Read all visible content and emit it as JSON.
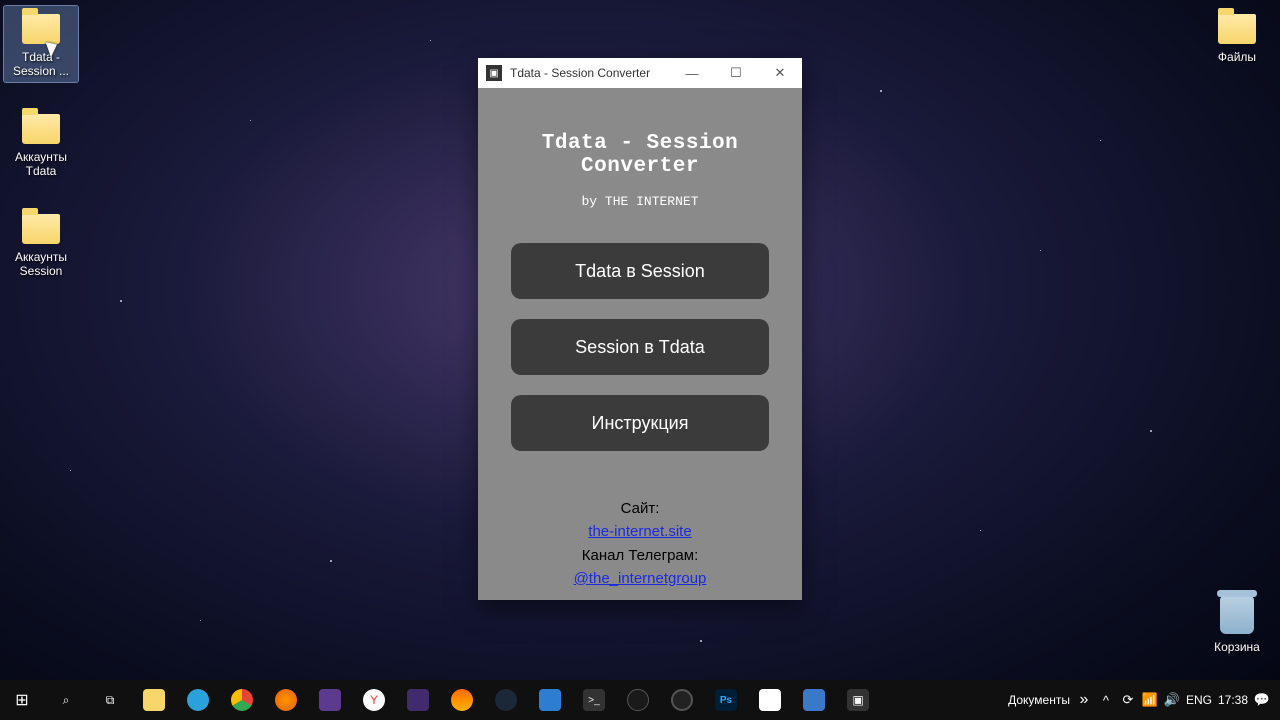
{
  "desktop": {
    "icons_left": [
      {
        "label": "Tdata - Session ...",
        "selected": true
      },
      {
        "label": "Аккаунты Tdata",
        "selected": false
      },
      {
        "label": "Аккаунты Session",
        "selected": false
      }
    ],
    "icons_right": [
      {
        "label": "Файлы"
      }
    ],
    "recycle_bin": "Корзина"
  },
  "window": {
    "title": "Tdata - Session Converter",
    "heading": "Tdata - Session Converter",
    "subheading": "by THE INTERNET",
    "buttons": {
      "tdata_to_session": "Tdata в Session",
      "session_to_tdata": "Session в Tdata",
      "instructions": "Инструкция"
    },
    "links": {
      "site_label": "Сайт:",
      "site_link": "the-internet.site",
      "tg_label": "Канал Телеграм:",
      "tg_link": "@the_internetgroup"
    }
  },
  "taskbar": {
    "tray_label": "Документы",
    "lang": "ENG",
    "time": "17:38"
  }
}
